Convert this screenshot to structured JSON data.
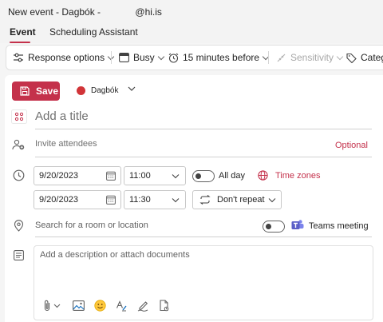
{
  "window": {
    "title": "New event - Dagbók -             @hi.is"
  },
  "tabs": [
    {
      "label": "Event",
      "active": true
    },
    {
      "label": "Scheduling Assistant",
      "active": false
    }
  ],
  "ribbon": {
    "response_options": "Response options",
    "busy": "Busy",
    "reminder": "15 minutes before",
    "sensitivity": "Sensitivity",
    "categorize": "Catego"
  },
  "toolbar": {
    "save_label": "Save",
    "calendar_name": "Dagbók",
    "calendar_color": "#d13438"
  },
  "event": {
    "title_placeholder": "Add a title",
    "attendees_placeholder": "Invite attendees",
    "optional_label": "Optional",
    "start_date": "9/20/2023",
    "start_time": "11:00",
    "all_day_label": "All day",
    "time_zones_label": "Time zones",
    "end_date": "9/20/2023",
    "end_time": "11:30",
    "repeat_label": "Don't repeat",
    "location_placeholder": "Search for a room or location",
    "teams_label": "Teams meeting",
    "description_placeholder": "Add a description or attach documents"
  },
  "colors": {
    "accent": "#c4314b",
    "teams": "#5b5fc7"
  }
}
